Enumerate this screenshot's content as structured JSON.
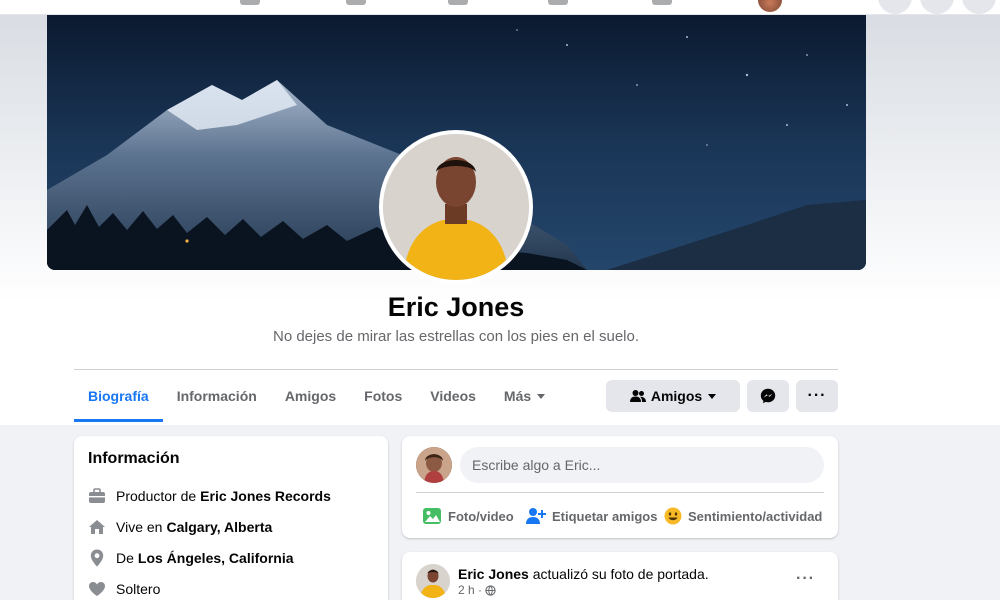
{
  "profile": {
    "name": "Eric Jones",
    "bio": "No dejes de mirar las estrellas con los pies en el suelo."
  },
  "tabs": [
    {
      "label": "Biografía",
      "active": true
    },
    {
      "label": "Información"
    },
    {
      "label": "Amigos"
    },
    {
      "label": "Fotos"
    },
    {
      "label": "Videos"
    },
    {
      "label": "Más"
    }
  ],
  "actions": {
    "friends_label": "Amigos",
    "more_label": "···"
  },
  "intro": {
    "title": "Información",
    "rows": [
      {
        "prefix": "Productor de",
        "bold": "Eric Jones Records",
        "icon": "briefcase-icon"
      },
      {
        "prefix": "Vive en",
        "bold": "Calgary, Alberta",
        "icon": "home-icon"
      },
      {
        "prefix": "De",
        "bold": "Los Ángeles, California",
        "icon": "location-pin-icon"
      },
      {
        "prefix": "Soltero",
        "bold": "",
        "icon": "heart-icon"
      }
    ]
  },
  "composer": {
    "placeholder": "Escribe algo a Eric...",
    "actions": [
      {
        "label": "Foto/video",
        "icon": "photo-icon",
        "color": "#45bd62"
      },
      {
        "label": "Etiquetar amigos",
        "icon": "tag-friends-icon",
        "color": "#1877f2"
      },
      {
        "label": "Sentimiento/actividad",
        "icon": "feeling-icon",
        "color": "#f7b928"
      }
    ]
  },
  "post": {
    "author": "Eric Jones",
    "action_text": "actualizó su foto de portada.",
    "time": "2 h ·",
    "more_label": "···"
  },
  "colors": {
    "accent": "#1877f2",
    "secondary_text": "#65676b",
    "button_bg": "#e4e6eb",
    "feed_bg": "#f0f2f5"
  }
}
